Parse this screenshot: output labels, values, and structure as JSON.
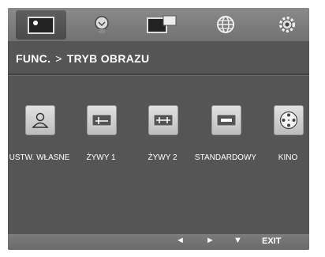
{
  "tabs": [
    {
      "icon": "picture-icon",
      "active": true
    },
    {
      "icon": "lightbulb-icon",
      "active": false
    },
    {
      "icon": "pip-icon",
      "active": false
    },
    {
      "icon": "globe-icon",
      "active": false
    },
    {
      "icon": "gear-icon",
      "active": false
    }
  ],
  "breadcrumb": {
    "parent": "FUNC.",
    "separator": ">",
    "current": "TRYB OBRAZU"
  },
  "modes": [
    {
      "label": "USTW. WŁASNE",
      "icon": "person-icon"
    },
    {
      "label": "ŻYWY 1",
      "icon": "vivid1-icon"
    },
    {
      "label": "ŻYWY 2",
      "icon": "vivid2-icon"
    },
    {
      "label": "STANDARDOWY",
      "icon": "standard-icon"
    },
    {
      "label": "KINO",
      "icon": "film-reel-icon"
    }
  ],
  "footer": {
    "left": "◄",
    "right": "►",
    "down": "▼",
    "exit": "EXIT"
  }
}
